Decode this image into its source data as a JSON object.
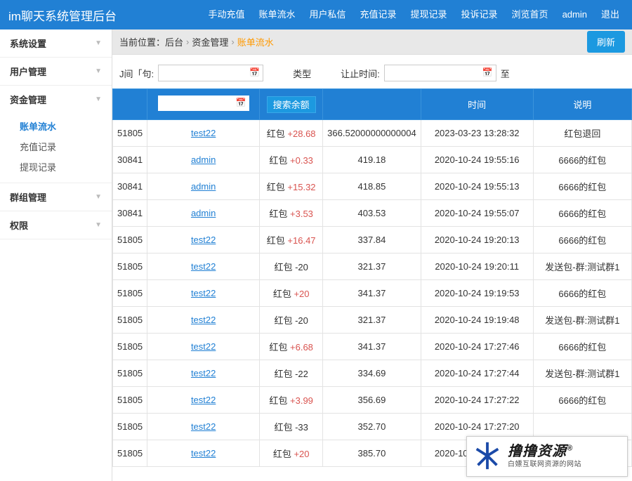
{
  "brand": "im聊天系统管理后台",
  "topnav": [
    "手动充值",
    "账单流水",
    "用户私信",
    "充值记录",
    "提现记录",
    "投诉记录",
    "浏览首页",
    "admin",
    "退出"
  ],
  "sidebar": [
    {
      "label": "系统设置",
      "expanded": false
    },
    {
      "label": "用户管理",
      "expanded": false
    },
    {
      "label": "资金管理",
      "expanded": true,
      "children": [
        {
          "label": "账单流水",
          "active": true
        },
        {
          "label": "充值记录"
        },
        {
          "label": "提现记录"
        }
      ]
    },
    {
      "label": "群组管理",
      "expanded": false
    },
    {
      "label": "权限",
      "expanded": false
    }
  ],
  "crumb": {
    "lead": "当前位置：后台",
    "mid": "资金管理",
    "active": "账单流水"
  },
  "refresh": "刷新",
  "filter": {
    "l1": "J间「句:",
    "mid": "类型",
    "l2": "让止时间:",
    "to": "至"
  },
  "thbtn": "搜索余额",
  "headers": [
    "",
    "",
    "",
    "",
    "时间",
    "说明"
  ],
  "rows": [
    {
      "id": "51805",
      "user": "test22",
      "type": "红包",
      "amt": "+28.68",
      "bal": "366.52000000000004",
      "time": "2023-03-23 13:28:32",
      "desc": "红包退回"
    },
    {
      "id": "30841",
      "user": "admin",
      "type": "红包",
      "amt": "+0.33",
      "bal": "419.18",
      "time": "2020-10-24 19:55:16",
      "desc": "6666的红包"
    },
    {
      "id": "30841",
      "user": "admin",
      "type": "红包",
      "amt": "+15.32",
      "bal": "418.85",
      "time": "2020-10-24 19:55:13",
      "desc": "6666的红包"
    },
    {
      "id": "30841",
      "user": "admin",
      "type": "红包",
      "amt": "+3.53",
      "bal": "403.53",
      "time": "2020-10-24 19:55:07",
      "desc": "6666的红包"
    },
    {
      "id": "51805",
      "user": "test22",
      "type": "红包",
      "amt": "+16.47",
      "bal": "337.84",
      "time": "2020-10-24 19:20:13",
      "desc": "6666的红包"
    },
    {
      "id": "51805",
      "user": "test22",
      "type": "红包",
      "amt": "-20",
      "bal": "321.37",
      "time": "2020-10-24 19:20:11",
      "desc": "发送包-群:测试群1"
    },
    {
      "id": "51805",
      "user": "test22",
      "type": "红包",
      "amt": "+20",
      "bal": "341.37",
      "time": "2020-10-24 19:19:53",
      "desc": "6666的红包"
    },
    {
      "id": "51805",
      "user": "test22",
      "type": "红包",
      "amt": "-20",
      "bal": "321.37",
      "time": "2020-10-24 19:19:48",
      "desc": "发送包-群:测试群1"
    },
    {
      "id": "51805",
      "user": "test22",
      "type": "红包",
      "amt": "+6.68",
      "bal": "341.37",
      "time": "2020-10-24 17:27:46",
      "desc": "6666的红包"
    },
    {
      "id": "51805",
      "user": "test22",
      "type": "红包",
      "amt": "-22",
      "bal": "334.69",
      "time": "2020-10-24 17:27:44",
      "desc": "发送包-群:测试群1"
    },
    {
      "id": "51805",
      "user": "test22",
      "type": "红包",
      "amt": "+3.99",
      "bal": "356.69",
      "time": "2020-10-24 17:27:22",
      "desc": "6666的红包"
    },
    {
      "id": "51805",
      "user": "test22",
      "type": "红包",
      "amt": "-33",
      "bal": "352.70",
      "time": "2020-10-24 17:27:20",
      "desc": ""
    },
    {
      "id": "51805",
      "user": "test22",
      "type": "红包",
      "amt": "+20",
      "bal": "385.70",
      "time": "2020-10-24 17:27:07",
      "desc": ""
    }
  ],
  "badge": {
    "title": "撸撸资源",
    "reg": "®",
    "sub": "白嫖互联网资源的网站"
  }
}
